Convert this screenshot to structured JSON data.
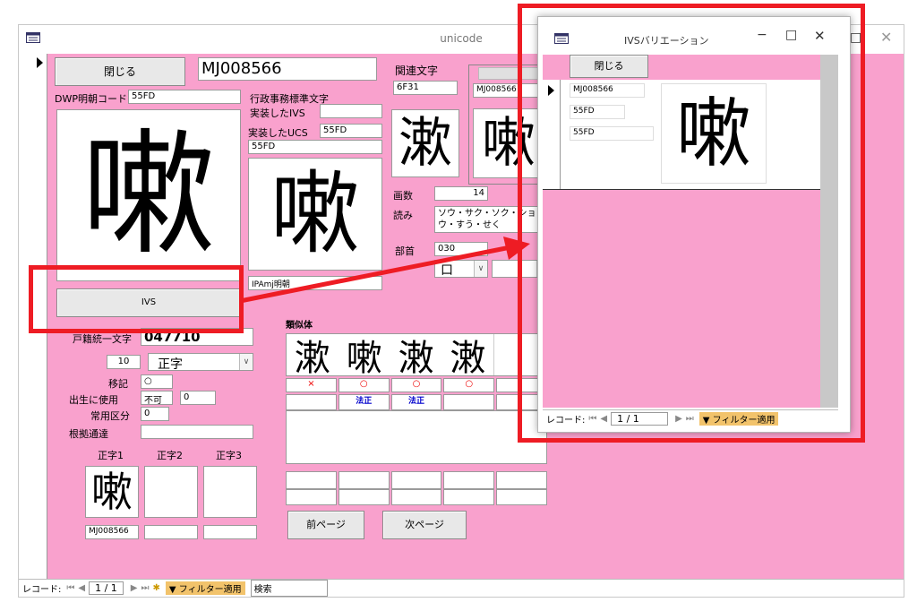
{
  "main": {
    "title": "unicode",
    "close_label": "閉じる",
    "mj_code": "MJ008566",
    "dwp_label": "DWP明朝コード",
    "dwp_value": "55FD",
    "glyph": "嗽",
    "admin_label": "行政事務標準文字",
    "ivs_impl_label": "実装したIVS",
    "ivs_impl_value": "",
    "ucs_impl_label": "実装したUCS",
    "ucs_impl_value": "55FD",
    "ucs_sub_value": "55FD",
    "ucs_bottom_value": "IPAmj明朝",
    "ivs_button_label": "IVS",
    "related_label": "関連文字",
    "related_code": "6F31",
    "related_glyph": "漱",
    "related_mj": "MJ008566",
    "related_mj_glyph": "嗽",
    "strokes_label": "画数",
    "strokes_value": "14",
    "reading_label": "読み",
    "reading_value": "ソウ・サク・ソク・ショウ・すう・せく",
    "radical_label": "部首",
    "radical_value": "030",
    "radical_glyph": "口",
    "koseki_label": "戸籍統一文字",
    "koseki_value": "047710",
    "seiji_num": "10",
    "seiji_value": "正字",
    "bikou_label": "移記",
    "bikou_value": "○",
    "birth_label": "出生に使用",
    "birth_value": "不可",
    "birth_num": "0",
    "joyo_label": "常用区分",
    "joyo_value": "0",
    "source_label": "根拠通達",
    "source_value": "",
    "seiji1_label": "正字1",
    "seiji2_label": "正字2",
    "seiji3_label": "正字3",
    "seiji1_glyph": "嗽",
    "seiji1_code": "MJ008566",
    "similar_label": "類似体",
    "similar_glyphs": [
      "漱",
      "嗽",
      "潄",
      "潄"
    ],
    "similar_marks": [
      "×",
      "○",
      "○",
      "○",
      ""
    ],
    "similar_notes": [
      "",
      "法正",
      "法正",
      "",
      ""
    ],
    "prev_page": "前ページ",
    "next_page": "次ページ",
    "nav_record_label": "レコード:",
    "nav_position": "1 / 1",
    "filter_label": "フィルター適用",
    "search_label": "検索"
  },
  "sub": {
    "title": "IVSバリエーション",
    "close_label": "閉じる",
    "mj_code": "MJ008566",
    "code1": "55FD",
    "code2": "55FD",
    "glyph": "嗽",
    "nav_record_label": "レコード:",
    "nav_position": "1 / 1",
    "filter_label": "フィルター適用"
  },
  "colors": {
    "form_bg": "#f9a1cd",
    "highlight": "#ee1c24",
    "filter": "#f2c36b"
  }
}
